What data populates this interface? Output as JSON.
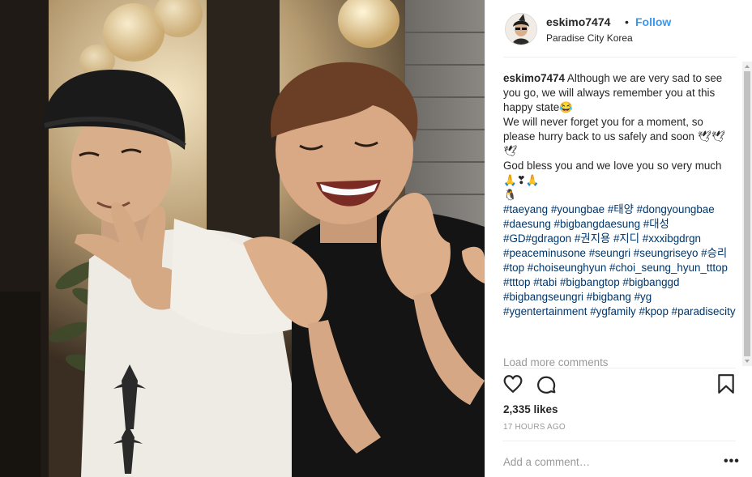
{
  "post": {
    "username": "eskimo7474",
    "separator": "•",
    "follow_label": "Follow",
    "location": "Paradise City Korea"
  },
  "caption": {
    "author": "eskimo7474",
    "line1": "Although we are very sad to see you go, we will always remember you at this happy state😂",
    "line2": "We will never forget you for a moment, so please hurry back to us safely and soon 🕊🕊🕊",
    "line3": "God bless you and we love you so very much🙏❣🙏",
    "line4": "🐧",
    "hashtags": "#taeyang #youngbae #태양 #dongyoungbae #daesung #bigbangdaesung #대성 #GD#gdragon #권지용 #지디 #xxxibgdrgn #peaceminusone #seungri #seungriseyo #승리 #top #choiseunghyun #choi_seung_hyun_tttop #tttop #tabi #bigbangtop #bigbanggd #bigbangseungri #bigbang #yg #ygentertainment #ygfamily #kpop #paradisecity"
  },
  "load_more": "Load more comments",
  "actions": {
    "like_icon": "heart-icon",
    "comment_icon": "comment-icon",
    "save_icon": "bookmark-icon"
  },
  "likes": "2,335 likes",
  "timestamp": "17 HOURS AGO",
  "add_comment_placeholder": "Add a comment…",
  "more_options": "•••",
  "colors": {
    "link": "#3897f0",
    "hashtag": "#003569",
    "text": "#262626",
    "muted": "#999999",
    "border": "#efefef"
  }
}
